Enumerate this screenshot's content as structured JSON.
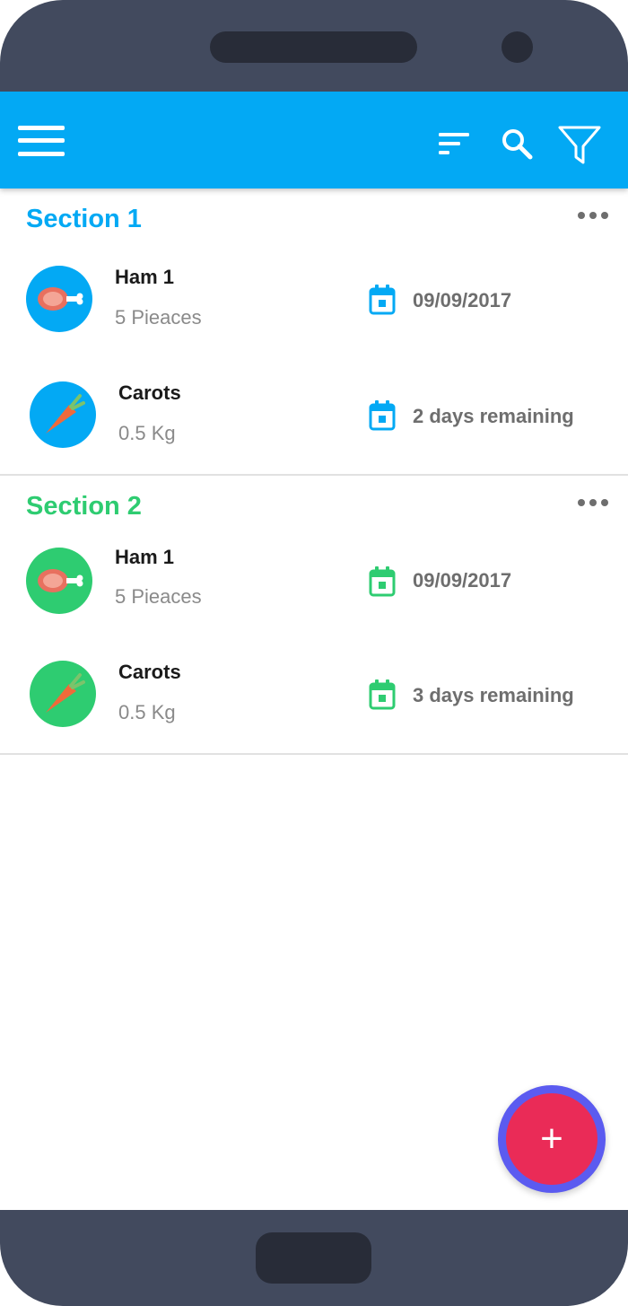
{
  "theme": {
    "primary": "#03a9f4",
    "accent_green": "#2ecc71",
    "fab": "#ea2b57",
    "fab_ring": "#5b5bf0"
  },
  "toolbar": {
    "menu_icon": "hamburger-menu-icon",
    "sort_icon": "sort-icon",
    "search_icon": "search-icon",
    "filter_icon": "filter-icon"
  },
  "sections": [
    {
      "title": "Section 1",
      "color": "#03a9f4",
      "items": [
        {
          "name": "Ham 1",
          "quantity": "5 Pieaces",
          "date": "09/09/2017",
          "icon": "ham-icon"
        },
        {
          "name": "Carots",
          "quantity": "0.5 Kg",
          "date": "2 days remaining",
          "icon": "carrot-icon"
        }
      ]
    },
    {
      "title": "Section 2",
      "color": "#2ecc71",
      "items": [
        {
          "name": "Ham 1",
          "quantity": "5 Pieaces",
          "date": "09/09/2017",
          "icon": "ham-icon"
        },
        {
          "name": "Carots",
          "quantity": "0.5 Kg",
          "date": "3 days remaining",
          "icon": "carrot-icon"
        }
      ]
    }
  ],
  "fab": {
    "label": "+"
  }
}
